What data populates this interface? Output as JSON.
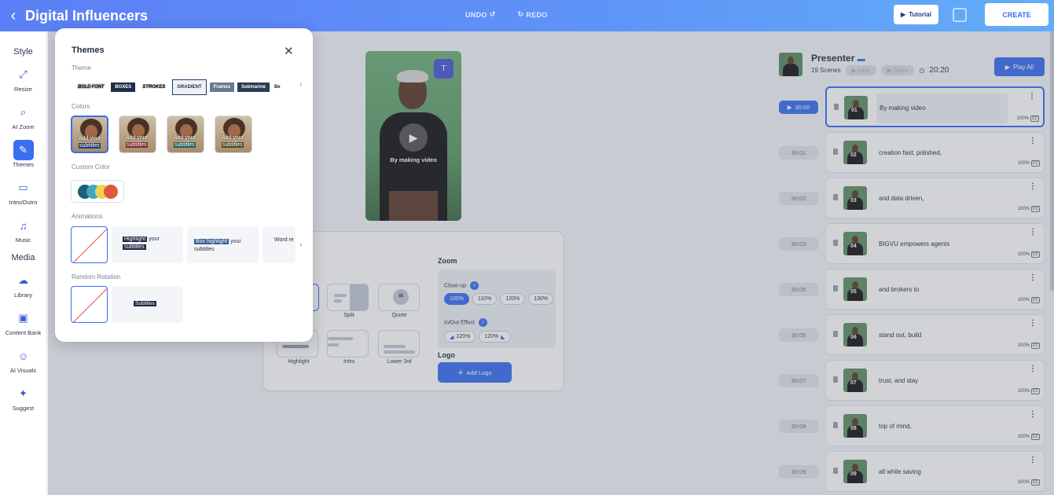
{
  "header": {
    "title": "Digital Influencers",
    "undo": "UNDO",
    "redo": "REDO",
    "tutorial": "Tutorial",
    "create": "CREATE"
  },
  "sidebar": {
    "style_section": "Style",
    "media_section": "Media",
    "items": [
      {
        "label": "Resize",
        "icon": "resize-icon"
      },
      {
        "label": "AI Zoom",
        "icon": "ai-zoom-icon"
      },
      {
        "label": "Themes",
        "icon": "themes-icon"
      },
      {
        "label": "Intro/Outro",
        "icon": "intro-outro-icon"
      },
      {
        "label": "Music",
        "icon": "music-icon"
      },
      {
        "label": "Library",
        "icon": "library-icon"
      },
      {
        "label": "Content Bank",
        "icon": "content-bank-icon"
      },
      {
        "label": "AI Visuals",
        "icon": "ai-visuals-icon"
      },
      {
        "label": "Suggest",
        "icon": "suggest-icon"
      }
    ]
  },
  "video": {
    "caption": "By making video"
  },
  "zoom": {
    "title": "Zoom",
    "closeup_label": "Close-up",
    "closeup_options": [
      "100%",
      "110%",
      "120%",
      "130%"
    ],
    "closeup_selected": "100%",
    "inout_label": "In/Out Effect",
    "inout_options": [
      "120%",
      "120%"
    ],
    "logo_title": "Logo",
    "add_logo": "Add Logo"
  },
  "layouts": [
    {
      "label": "Split"
    },
    {
      "label": "Quote"
    },
    {
      "label": "Highlight"
    },
    {
      "label": "Intro"
    },
    {
      "label": "Lower 3rd"
    }
  ],
  "presenter": {
    "title": "Presenter",
    "scenes_count": "19 Scenes",
    "intro": "Intro",
    "outro": "Outro",
    "duration": "20:20",
    "play_all": "Play All"
  },
  "scenes": [
    {
      "time": "30:00",
      "num": "01",
      "text": "By making video",
      "pct": "100%",
      "cc": "CC"
    },
    {
      "time": "30:01",
      "num": "02",
      "text": "creation fast, polished,",
      "pct": "100%",
      "cc": "CC"
    },
    {
      "time": "30:02",
      "num": "03",
      "text": "and data driven,",
      "pct": "100%",
      "cc": "CC"
    },
    {
      "time": "30:03",
      "num": "04",
      "text": "BIGVU empowers agents",
      "pct": "100%",
      "cc": "CC"
    },
    {
      "time": "30:05",
      "num": "05",
      "text": "and brokers to",
      "pct": "100%",
      "cc": "CC"
    },
    {
      "time": "30:05",
      "num": "06",
      "text": "stand out, build",
      "pct": "100%",
      "cc": "CC"
    },
    {
      "time": "30:07",
      "num": "07",
      "text": "trust, and stay",
      "pct": "100%",
      "cc": "CC"
    },
    {
      "time": "30:08",
      "num": "08",
      "text": "top of mind,",
      "pct": "100%",
      "cc": "CC"
    },
    {
      "time": "30:09",
      "num": "09",
      "text": "all while saving",
      "pct": "100%",
      "cc": "CC"
    }
  ],
  "themes_modal": {
    "title": "Themes",
    "theme_label": "Theme",
    "themes": [
      "BOLD FONT",
      "BOXES",
      "STROKES",
      "GRADIENT",
      "Frames",
      "Submarine",
      "Be"
    ],
    "selected_theme": "GRADIENT",
    "colors_label": "Colors",
    "color_text_line1": "Add your",
    "color_text_line2": "subtitles",
    "custom_color_label": "Custom Color",
    "custom_colors": [
      "#1f5f78",
      "#3fa6c4",
      "#f0d253",
      "#e0583e"
    ],
    "animations_label": "Animations",
    "anim_highlight": "Highlight",
    "anim_your": "your",
    "anim_subtitles": "subtitles",
    "anim_box_highlight": "Box highlight",
    "anim_word": "Word re",
    "random_rotation_label": "Random Rotation",
    "rotation_subtitles": "Subtitles"
  }
}
